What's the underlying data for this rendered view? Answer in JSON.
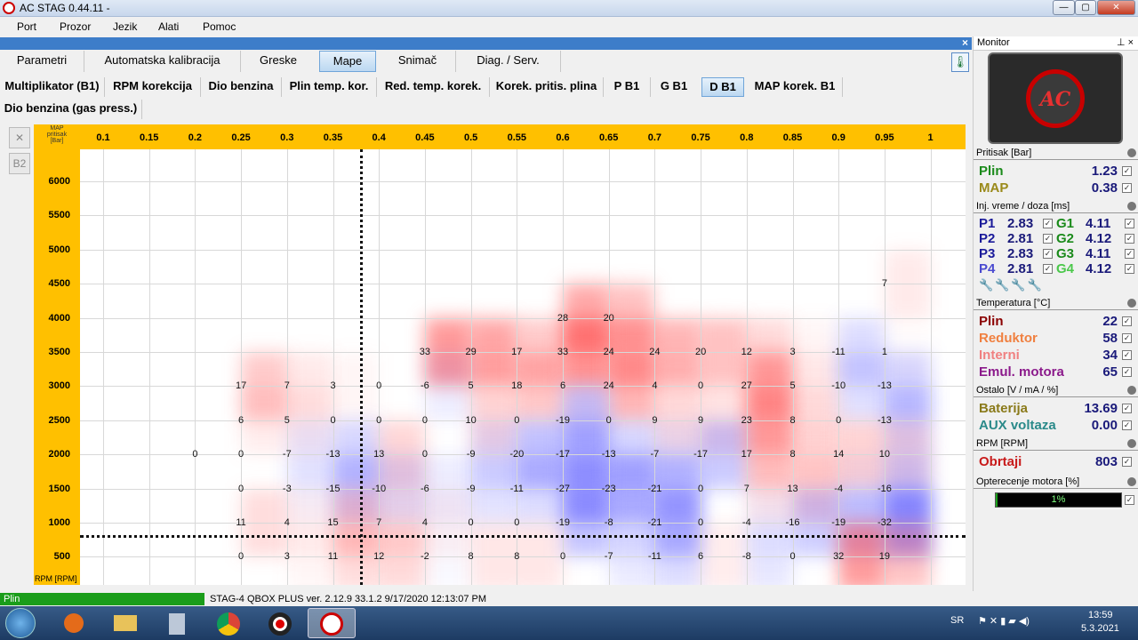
{
  "window": {
    "title": "AC STAG 0.44.11 -",
    "min": "—",
    "max": "▢",
    "close": "✕"
  },
  "menu": [
    "Port",
    "Prozor",
    "Jezik",
    "Alati",
    "Pomoc"
  ],
  "panel_close": "×",
  "tabs": [
    "Parametri",
    "Automatska kalibracija",
    "Greske",
    "Mape",
    "Snimač",
    "Diag. / Serv."
  ],
  "subtabs": [
    "Multiplikator (B1)",
    "RPM korekcija",
    "Dio benzina",
    "Plin temp. kor.",
    "Red. temp. korek.",
    "Korek. pritis. plina",
    "P B1",
    "G B1",
    "D B1",
    "MAP korek. B1"
  ],
  "subtab2": "Dio benzina (gas press.)",
  "tools": {
    "clear": "✕",
    "b2": "B2"
  },
  "map": {
    "corner_line1": "MAP",
    "corner_line2": "pritisak",
    "corner_line3": "[Bar]",
    "y_unit": "RPM [RPM]",
    "x_ticks": [
      "0.1",
      "0.15",
      "0.2",
      "0.25",
      "0.3",
      "0.35",
      "0.4",
      "0.45",
      "0.5",
      "0.55",
      "0.6",
      "0.65",
      "0.7",
      "0.75",
      "0.8",
      "0.85",
      "0.9",
      "0.95",
      "1"
    ],
    "y_ticks": [
      "6000",
      "5500",
      "5000",
      "4500",
      "4000",
      "3500",
      "3000",
      "2500",
      "2000",
      "1500",
      "1000",
      "500"
    ]
  },
  "chart_data": {
    "type": "heatmap",
    "title": "Dio benzina (gas press.)",
    "xlabel": "MAP pritisak [Bar]",
    "ylabel": "RPM [RPM]",
    "x": [
      0.1,
      0.15,
      0.2,
      0.25,
      0.3,
      0.35,
      0.4,
      0.45,
      0.5,
      0.55,
      0.6,
      0.65,
      0.7,
      0.75,
      0.8,
      0.85,
      0.9,
      0.95,
      1
    ],
    "y": [
      6000,
      5500,
      5000,
      4500,
      4000,
      3500,
      3000,
      2500,
      2000,
      1500,
      1000,
      500
    ],
    "cursor": {
      "x": 0.38,
      "rpm": 803
    },
    "points": [
      [
        0.95,
        4500,
        7
      ],
      [
        0.6,
        4000,
        28
      ],
      [
        0.65,
        4000,
        20
      ],
      [
        0.45,
        3500,
        33
      ],
      [
        0.5,
        3500,
        29
      ],
      [
        0.55,
        3500,
        17
      ],
      [
        0.6,
        3500,
        33
      ],
      [
        0.65,
        3500,
        24
      ],
      [
        0.7,
        3500,
        24
      ],
      [
        0.75,
        3500,
        20
      ],
      [
        0.8,
        3500,
        12
      ],
      [
        0.85,
        3500,
        3
      ],
      [
        0.9,
        3500,
        -11
      ],
      [
        0.95,
        3500,
        1
      ],
      [
        0.25,
        3000,
        17
      ],
      [
        0.3,
        3000,
        7
      ],
      [
        0.35,
        3000,
        3
      ],
      [
        0.4,
        3000,
        0
      ],
      [
        0.45,
        3000,
        -6
      ],
      [
        0.5,
        3000,
        5
      ],
      [
        0.55,
        3000,
        18
      ],
      [
        0.6,
        3000,
        6
      ],
      [
        0.65,
        3000,
        24
      ],
      [
        0.7,
        3000,
        4
      ],
      [
        0.75,
        3000,
        0
      ],
      [
        0.8,
        3000,
        27
      ],
      [
        0.85,
        3000,
        5
      ],
      [
        0.9,
        3000,
        -10
      ],
      [
        0.95,
        3000,
        -13
      ],
      [
        0.25,
        2500,
        6
      ],
      [
        0.3,
        2500,
        5
      ],
      [
        0.35,
        2500,
        0
      ],
      [
        0.4,
        2500,
        0
      ],
      [
        0.45,
        2500,
        0
      ],
      [
        0.5,
        2500,
        10
      ],
      [
        0.55,
        2500,
        0
      ],
      [
        0.6,
        2500,
        -19
      ],
      [
        0.65,
        2500,
        0
      ],
      [
        0.7,
        2500,
        9
      ],
      [
        0.75,
        2500,
        9
      ],
      [
        0.8,
        2500,
        23
      ],
      [
        0.85,
        2500,
        8
      ],
      [
        0.9,
        2500,
        0
      ],
      [
        0.95,
        2500,
        -13
      ],
      [
        0.2,
        2000,
        0
      ],
      [
        0.25,
        2000,
        0
      ],
      [
        0.3,
        2000,
        -7
      ],
      [
        0.35,
        2000,
        -13
      ],
      [
        0.4,
        2000,
        13
      ],
      [
        0.45,
        2000,
        0
      ],
      [
        0.5,
        2000,
        -9
      ],
      [
        0.55,
        2000,
        -20
      ],
      [
        0.6,
        2000,
        -17
      ],
      [
        0.65,
        2000,
        -13
      ],
      [
        0.7,
        2000,
        -7
      ],
      [
        0.75,
        2000,
        -17
      ],
      [
        0.8,
        2000,
        17
      ],
      [
        0.85,
        2000,
        8
      ],
      [
        0.9,
        2000,
        14
      ],
      [
        0.95,
        2000,
        10
      ],
      [
        0.25,
        1500,
        0
      ],
      [
        0.3,
        1500,
        -3
      ],
      [
        0.35,
        1500,
        -15
      ],
      [
        0.4,
        1500,
        -10
      ],
      [
        0.45,
        1500,
        -6
      ],
      [
        0.5,
        1500,
        -9
      ],
      [
        0.55,
        1500,
        -11
      ],
      [
        0.6,
        1500,
        -27
      ],
      [
        0.65,
        1500,
        -23
      ],
      [
        0.7,
        1500,
        -21
      ],
      [
        0.75,
        1500,
        0
      ],
      [
        0.8,
        1500,
        7
      ],
      [
        0.85,
        1500,
        13
      ],
      [
        0.9,
        1500,
        -4
      ],
      [
        0.95,
        1500,
        -16
      ],
      [
        0.25,
        1000,
        11
      ],
      [
        0.3,
        1000,
        4
      ],
      [
        0.35,
        1000,
        15
      ],
      [
        0.4,
        1000,
        7
      ],
      [
        0.45,
        1000,
        4
      ],
      [
        0.5,
        1000,
        0
      ],
      [
        0.55,
        1000,
        0
      ],
      [
        0.6,
        1000,
        -19
      ],
      [
        0.65,
        1000,
        -8
      ],
      [
        0.7,
        1000,
        -21
      ],
      [
        0.75,
        1000,
        0
      ],
      [
        0.8,
        1000,
        -4
      ],
      [
        0.85,
        1000,
        -16
      ],
      [
        0.9,
        1000,
        -19
      ],
      [
        0.95,
        1000,
        -32
      ],
      [
        0.25,
        500,
        0
      ],
      [
        0.3,
        500,
        3
      ],
      [
        0.35,
        500,
        11
      ],
      [
        0.4,
        500,
        12
      ],
      [
        0.45,
        500,
        -2
      ],
      [
        0.5,
        500,
        8
      ],
      [
        0.55,
        500,
        8
      ],
      [
        0.6,
        500,
        0
      ],
      [
        0.65,
        500,
        -7
      ],
      [
        0.7,
        500,
        -11
      ],
      [
        0.75,
        500,
        6
      ],
      [
        0.8,
        500,
        -8
      ],
      [
        0.85,
        500,
        0
      ],
      [
        0.9,
        500,
        32
      ],
      [
        0.95,
        500,
        19
      ]
    ],
    "colors": {
      "positive": "#ff3c3c",
      "negative": "#3c3cff"
    }
  },
  "monitor": {
    "title": "Monitor",
    "pin": "⊥ ×",
    "pritisak_label": "Pritisak [Bar]",
    "plin_label": "Plin",
    "plin_value": "1.23",
    "map_label": "MAP",
    "map_value": "0.38",
    "inj_label": "Inj. vreme / doza [ms]",
    "inj": [
      {
        "p": "P1",
        "pv": "2.83",
        "g": "G1",
        "gv": "4.11"
      },
      {
        "p": "P2",
        "pv": "2.81",
        "g": "G2",
        "gv": "4.12"
      },
      {
        "p": "P3",
        "pv": "2.83",
        "g": "G3",
        "gv": "4.11"
      },
      {
        "p": "P4",
        "pv": "2.81",
        "g": "G4",
        "gv": "4.12"
      }
    ],
    "temp_label": "Temperatura [°C]",
    "temps": [
      {
        "label": "Plin",
        "value": "22",
        "color": "#8b0000"
      },
      {
        "label": "Reduktor",
        "value": "58",
        "color": "#f08040"
      },
      {
        "label": "Interni",
        "value": "34",
        "color": "#f08080"
      },
      {
        "label": "Emul. motora",
        "value": "65",
        "color": "#8b1a8b"
      }
    ],
    "ostalo_label": "Ostalo [V / mA / %]",
    "baterija_label": "Baterija",
    "baterija_value": "13.69",
    "aux_label": "AUX voltaza",
    "aux_value": "0.00",
    "rpm_label": "RPM [RPM]",
    "obrtaji_label": "Obrtaji",
    "obrtaji_value": "803",
    "load_label": "Opterecenje motora [%]",
    "load_value": "1%",
    "load_fraction": 0.01
  },
  "status": {
    "fuel": "Plin",
    "info": "STAG-4 QBOX PLUS  ver. 2.12.9  33.1.2  9/17/2020 12:13:07 PM"
  },
  "taskbar": {
    "lang": "SR",
    "time": "13:59",
    "date": "5.3.2021"
  }
}
